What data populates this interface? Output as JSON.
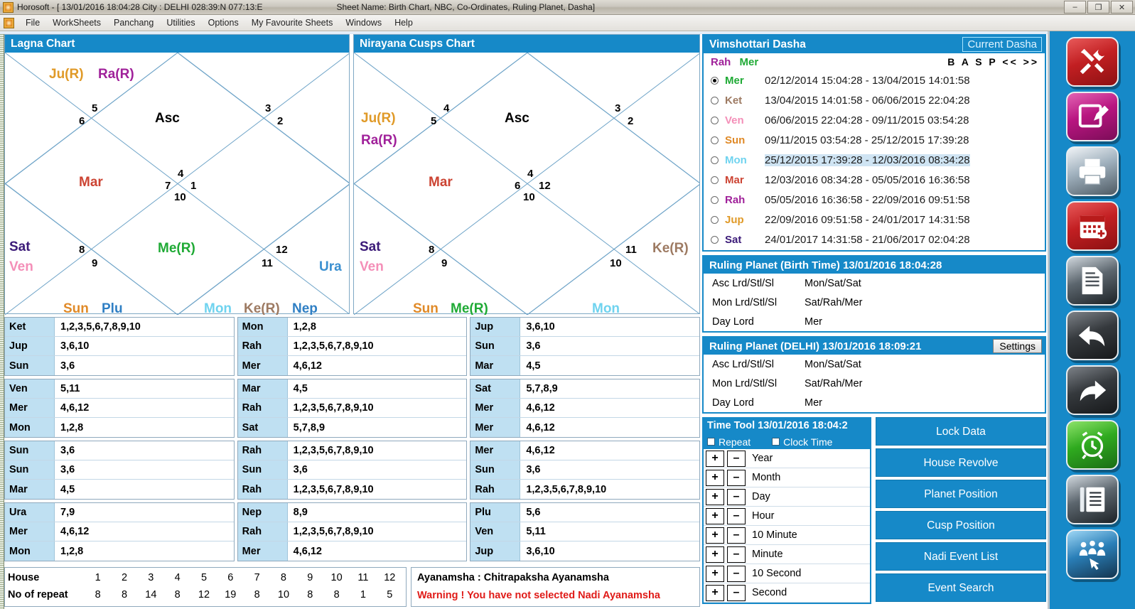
{
  "window": {
    "title": "Horosoft - [ 13/01/2016 18:04:28  City : DELHI 028:39:N 077:13:E",
    "sheet_name": "Sheet Name: Birth Chart, NBC, Co-Ordinates, Ruling Planet, Dasha]",
    "min_label": "–",
    "restore_label": "❐",
    "close_label": "✕",
    "inner_min": "_",
    "inner_restore": "❐",
    "inner_close": "✕"
  },
  "menu": {
    "items": [
      "File",
      "WorkSheets",
      "Panchang",
      "Utilities",
      "Options",
      "My Favourite Sheets",
      "Windows",
      "Help"
    ]
  },
  "lagna_chart": {
    "title": "Lagna Chart",
    "asc_label": "Asc",
    "house_numbers": [
      "5",
      "6",
      "3",
      "2",
      "4",
      "7",
      "1",
      "10",
      "8",
      "9",
      "12",
      "11"
    ],
    "planets": [
      {
        "label": "Ju(R)",
        "color_class": "p-ju"
      },
      {
        "label": "Ra(R)",
        "color_class": "p-ra"
      },
      {
        "label": "Mar",
        "color_class": "p-mar"
      },
      {
        "label": "Sat",
        "color_class": "p-sat"
      },
      {
        "label": "Ven",
        "color_class": "p-ven"
      },
      {
        "label": "Me(R)",
        "color_class": "p-me"
      },
      {
        "label": "Ura",
        "color_class": "p-ura"
      },
      {
        "label": "Sun",
        "color_class": "p-sun"
      },
      {
        "label": "Plu",
        "color_class": "p-plu"
      },
      {
        "label": "Mon",
        "color_class": "p-mon"
      },
      {
        "label": "Ke(R)",
        "color_class": "p-ke"
      },
      {
        "label": "Nep",
        "color_class": "p-nep"
      }
    ]
  },
  "cusps_chart": {
    "title": "Nirayana Cusps Chart",
    "asc_label": "Asc",
    "house_numbers": [
      "4",
      "5",
      "3",
      "2",
      "4",
      "6",
      "12",
      "10",
      "8",
      "9",
      "11",
      "10"
    ],
    "planets": [
      {
        "label": "Ju(R)",
        "color_class": "p-ju"
      },
      {
        "label": "Ra(R)",
        "color_class": "p-ra"
      },
      {
        "label": "Mar",
        "color_class": "p-mar"
      },
      {
        "label": "Sat",
        "color_class": "p-sat"
      },
      {
        "label": "Ven",
        "color_class": "p-ven"
      },
      {
        "label": "Ke(R)",
        "color_class": "p-ke"
      },
      {
        "label": "Sun",
        "color_class": "p-sun"
      },
      {
        "label": "Me(R)",
        "color_class": "p-me"
      },
      {
        "label": "Mon",
        "color_class": "p-mon"
      }
    ]
  },
  "tables": {
    "col1": [
      [
        {
          "k": "Ket",
          "v": "1,2,3,5,6,7,8,9,10"
        },
        {
          "k": "Jup",
          "v": "3,6,10"
        },
        {
          "k": "Sun",
          "v": "3,6"
        }
      ],
      [
        {
          "k": "Ven",
          "v": "5,11"
        },
        {
          "k": "Mer",
          "v": "4,6,12"
        },
        {
          "k": "Mon",
          "v": "1,2,8"
        }
      ],
      [
        {
          "k": "Sun",
          "v": "3,6"
        },
        {
          "k": "Sun",
          "v": "3,6"
        },
        {
          "k": "Mar",
          "v": "4,5"
        }
      ],
      [
        {
          "k": "Ura",
          "v": "7,9"
        },
        {
          "k": "Mer",
          "v": "4,6,12"
        },
        {
          "k": "Mon",
          "v": "1,2,8"
        }
      ]
    ],
    "col2": [
      [
        {
          "k": "Mon",
          "v": "1,2,8"
        },
        {
          "k": "Rah",
          "v": "1,2,3,5,6,7,8,9,10"
        },
        {
          "k": "Mer",
          "v": "4,6,12"
        }
      ],
      [
        {
          "k": "Mar",
          "v": "4,5"
        },
        {
          "k": "Rah",
          "v": "1,2,3,5,6,7,8,9,10"
        },
        {
          "k": "Sat",
          "v": "5,7,8,9"
        }
      ],
      [
        {
          "k": "Rah",
          "v": "1,2,3,5,6,7,8,9,10"
        },
        {
          "k": "Sun",
          "v": "3,6"
        },
        {
          "k": "Rah",
          "v": "1,2,3,5,6,7,8,9,10"
        }
      ],
      [
        {
          "k": "Nep",
          "v": "8,9"
        },
        {
          "k": "Rah",
          "v": "1,2,3,5,6,7,8,9,10"
        },
        {
          "k": "Mer",
          "v": "4,6,12"
        }
      ]
    ],
    "col3": [
      [
        {
          "k": "Jup",
          "v": "3,6,10"
        },
        {
          "k": "Sun",
          "v": "3,6"
        },
        {
          "k": "Mar",
          "v": "4,5"
        }
      ],
      [
        {
          "k": "Sat",
          "v": "5,7,8,9"
        },
        {
          "k": "Mer",
          "v": "4,6,12"
        },
        {
          "k": "Mer",
          "v": "4,6,12"
        }
      ],
      [
        {
          "k": "Mer",
          "v": "4,6,12"
        },
        {
          "k": "Sun",
          "v": "3,6"
        },
        {
          "k": "Rah",
          "v": "1,2,3,5,6,7,8,9,10"
        }
      ],
      [
        {
          "k": "Plu",
          "v": "5,6"
        },
        {
          "k": "Ven",
          "v": "5,11"
        },
        {
          "k": "Jup",
          "v": "3,6,10"
        }
      ]
    ]
  },
  "house_repeat": {
    "house_label": "House",
    "repeat_label": "No of repeat",
    "houses": [
      "1",
      "2",
      "3",
      "4",
      "5",
      "6",
      "7",
      "8",
      "9",
      "10",
      "11",
      "12"
    ],
    "repeats": [
      "8",
      "8",
      "14",
      "8",
      "12",
      "19",
      "8",
      "10",
      "8",
      "8",
      "1",
      "5"
    ]
  },
  "ayanamsha": {
    "line1": "Ayanamsha : Chitrapaksha Ayanamsha",
    "line2": "Warning ! You have not selected Nadi Ayanamsha"
  },
  "dasha": {
    "title": "Vimshottari Dasha",
    "current_button": "Current Dasha",
    "maha": "Rah",
    "antar": "Mer",
    "nav": "B A S P << >>",
    "rows": [
      {
        "planet": "Mer",
        "color_class": "p-me",
        "period": "02/12/2014 15:04:28 - 13/04/2015 14:01:58",
        "selected_radio": true,
        "highlight": false
      },
      {
        "planet": "Ket",
        "color_class": "p-ke",
        "period": "13/04/2015 14:01:58 - 06/06/2015 22:04:28",
        "selected_radio": false,
        "highlight": false
      },
      {
        "planet": "Ven",
        "color_class": "p-ven",
        "period": "06/06/2015 22:04:28 - 09/11/2015 03:54:28",
        "selected_radio": false,
        "highlight": false
      },
      {
        "planet": "Sun",
        "color_class": "p-sun",
        "period": "09/11/2015 03:54:28 - 25/12/2015 17:39:28",
        "selected_radio": false,
        "highlight": false
      },
      {
        "planet": "Mon",
        "color_class": "p-mon",
        "period": "25/12/2015 17:39:28 - 12/03/2016 08:34:28",
        "selected_radio": false,
        "highlight": true
      },
      {
        "planet": "Mar",
        "color_class": "p-mar",
        "period": "12/03/2016 08:34:28 - 05/05/2016 16:36:58",
        "selected_radio": false,
        "highlight": false
      },
      {
        "planet": "Rah",
        "color_class": "p-ra",
        "period": "05/05/2016 16:36:58 - 22/09/2016 09:51:58",
        "selected_radio": false,
        "highlight": false
      },
      {
        "planet": "Jup",
        "color_class": "p-ju",
        "period": "22/09/2016 09:51:58 - 24/01/2017 14:31:58",
        "selected_radio": false,
        "highlight": false
      },
      {
        "planet": "Sat",
        "color_class": "p-sat",
        "period": "24/01/2017 14:31:58 - 21/06/2017 02:04:28",
        "selected_radio": false,
        "highlight": false
      }
    ]
  },
  "ruling_birth": {
    "title": "Ruling Planet (Birth Time) 13/01/2016 18:04:28",
    "rows": [
      {
        "k": "Asc Lrd/Stl/Sl",
        "v": "Mon/Sat/Sat"
      },
      {
        "k": "Mon Lrd/Stl/Sl",
        "v": "Sat/Rah/Mer"
      },
      {
        "k": "Day Lord",
        "v": "Mer"
      }
    ]
  },
  "ruling_delhi": {
    "title": "Ruling Planet (DELHI) 13/01/2016 18:09:21",
    "settings_label": "Settings",
    "rows": [
      {
        "k": "Asc Lrd/Stl/Sl",
        "v": "Mon/Sat/Sat"
      },
      {
        "k": "Mon Lrd/Stl/Sl",
        "v": "Sat/Rah/Mer"
      },
      {
        "k": "Day Lord",
        "v": "Mer"
      }
    ]
  },
  "time_tool": {
    "title": "Time Tool 13/01/2016 18:04:2",
    "repeat_label": "Repeat",
    "clock_label": "Clock Time",
    "plus": "+",
    "minus": "–",
    "units": [
      "Year",
      "Month",
      "Day",
      "Hour",
      "10 Minute",
      "Minute",
      "10 Second",
      "Second"
    ]
  },
  "action_buttons": [
    "Lock Data",
    "House Revolve",
    "Planet Position",
    "Cusp Position",
    "Nadi Event List",
    "Event Search"
  ],
  "toolbar_icons": [
    {
      "name": "tools-icon",
      "style": "g-red"
    },
    {
      "name": "edit-note-icon",
      "style": "g-mag"
    },
    {
      "name": "printer-icon",
      "style": "g-gry"
    },
    {
      "name": "calendar-add-icon",
      "style": "g-red"
    },
    {
      "name": "document-click-icon",
      "style": "g-drk"
    },
    {
      "name": "back-arrow-icon",
      "style": "g-blk"
    },
    {
      "name": "forward-arrow-icon",
      "style": "g-blk"
    },
    {
      "name": "alarm-clock-icon",
      "style": "g-grn"
    },
    {
      "name": "notebook-icon",
      "style": "g-drk"
    },
    {
      "name": "group-select-icon",
      "style": "g-blu"
    }
  ],
  "colors": {
    "accent": "#1689c8",
    "warning": "#e01b18",
    "key_cell": "#bfe0f2"
  }
}
